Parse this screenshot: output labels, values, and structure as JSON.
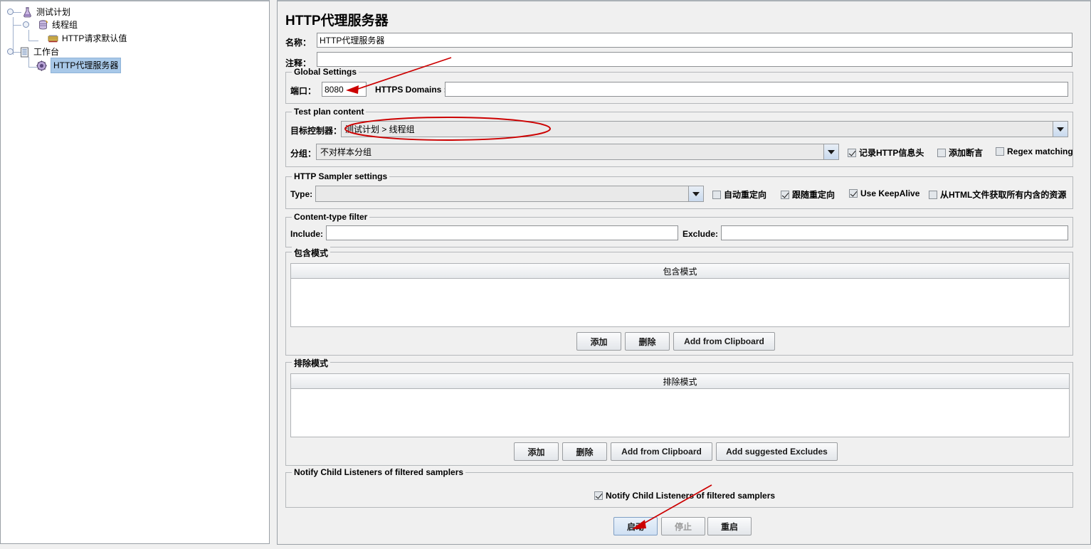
{
  "tree": {
    "items": [
      {
        "label": "测试计划",
        "icon": "test-plan-icon",
        "depth": 0,
        "selected": false
      },
      {
        "label": "线程组",
        "icon": "thread-group-icon",
        "depth": 1,
        "selected": false
      },
      {
        "label": "HTTP请求默认值",
        "icon": "http-defaults-icon",
        "depth": 2,
        "selected": false
      },
      {
        "label": "工作台",
        "icon": "workbench-icon",
        "depth": 0,
        "selected": false
      },
      {
        "label": "HTTP代理服务器",
        "icon": "http-proxy-icon",
        "depth": 1,
        "selected": true
      }
    ]
  },
  "panel": {
    "title": "HTTP代理服务器",
    "name_label": "名称：",
    "name_value": "HTTP代理服务器",
    "comment_label": "注释：",
    "comment_value": ""
  },
  "global_settings": {
    "title": "Global Settings",
    "port_label": "端口：",
    "port_value": "8080",
    "https_domains_label": "HTTPS Domains :",
    "https_domains_value": ""
  },
  "test_plan_content": {
    "title": "Test plan content",
    "target_controller_label": "目标控制器：",
    "target_controller_value": "测试计划 > 线程组",
    "grouping_label": "分组：",
    "grouping_value": "不对样本分组",
    "checkboxes": [
      {
        "label": "记录HTTP信息头",
        "checked": true
      },
      {
        "label": "添加断言",
        "checked": false
      },
      {
        "label": "Regex matching",
        "checked": false
      }
    ]
  },
  "http_sampler_settings": {
    "title": "HTTP Sampler settings",
    "type_label": "Type:",
    "type_value": "",
    "checkboxes": [
      {
        "label": "自动重定向",
        "checked": false
      },
      {
        "label": "跟随重定向",
        "checked": true
      },
      {
        "label": "Use KeepAlive",
        "checked": true
      },
      {
        "label": "从HTML文件获取所有内含的资源",
        "checked": false
      }
    ]
  },
  "content_type_filter": {
    "title": "Content-type filter",
    "include_label": "Include:",
    "include_value": "",
    "exclude_label": "Exclude:",
    "exclude_value": ""
  },
  "include_patterns": {
    "title": "包含模式",
    "column_header": "包含模式",
    "rows": [],
    "buttons": [
      {
        "label": "添加",
        "name": "add-button"
      },
      {
        "label": "删除",
        "name": "delete-button"
      },
      {
        "label": "Add from Clipboard",
        "name": "add-from-clipboard-button"
      }
    ]
  },
  "exclude_patterns": {
    "title": "排除模式",
    "column_header": "排除模式",
    "rows": [],
    "buttons": [
      {
        "label": "添加",
        "name": "add-button"
      },
      {
        "label": "删除",
        "name": "delete-button"
      },
      {
        "label": "Add from Clipboard",
        "name": "add-from-clipboard-button"
      },
      {
        "label": "Add suggested Excludes",
        "name": "add-suggested-excludes-button"
      }
    ]
  },
  "notify_child_listeners": {
    "title": "Notify Child Listeners of filtered samplers",
    "checkbox_label": "Notify Child Listeners of filtered samplers",
    "checked": true
  },
  "control_buttons": [
    {
      "label": "启动",
      "name": "start-button",
      "enabled": true
    },
    {
      "label": "停止",
      "name": "stop-button",
      "enabled": false
    },
    {
      "label": "重启",
      "name": "restart-button",
      "enabled": true
    }
  ],
  "annotations": {
    "color": "#cc0000",
    "marks": [
      {
        "type": "arrow",
        "target": "port-field"
      },
      {
        "type": "ellipse",
        "target": "target-controller-combo"
      },
      {
        "type": "arrow",
        "target": "start-button"
      }
    ]
  }
}
